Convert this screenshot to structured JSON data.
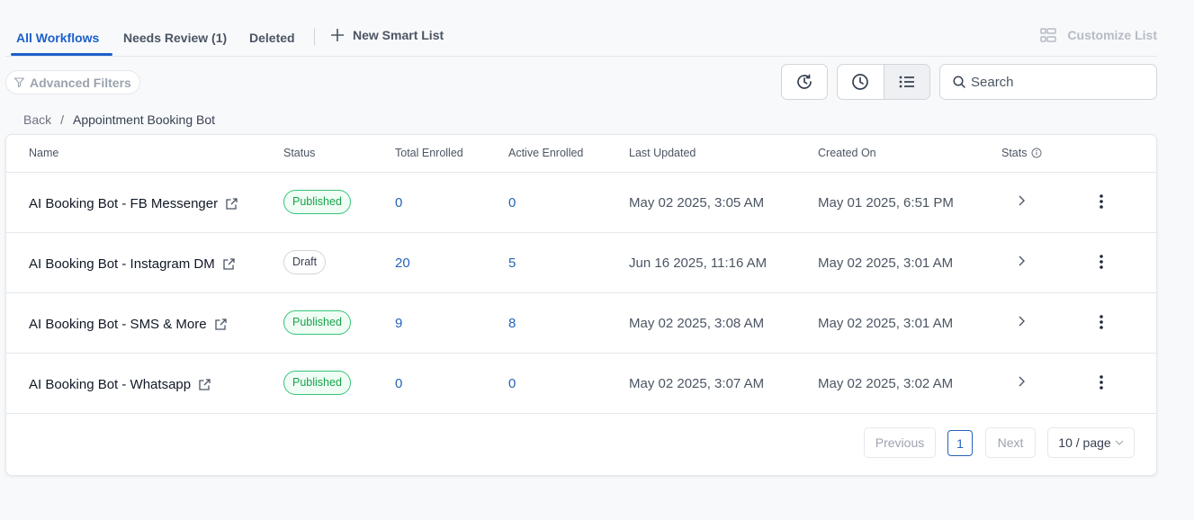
{
  "tabs": {
    "all": "All Workflows",
    "review": "Needs Review (1)",
    "deleted": "Deleted",
    "new_list": "New Smart List",
    "customize": "Customize List"
  },
  "filters": {
    "advanced": "Advanced Filters",
    "search_placeholder": "Search"
  },
  "breadcrumb": {
    "back": "Back",
    "separator": "/",
    "current": "Appointment Booking Bot"
  },
  "table": {
    "headers": {
      "name": "Name",
      "status": "Status",
      "total": "Total Enrolled",
      "active": "Active Enrolled",
      "updated": "Last Updated",
      "created": "Created On",
      "stats": "Stats"
    },
    "rows": [
      {
        "name": "AI Booking Bot - FB Messenger",
        "status": "Published",
        "total": "0",
        "active": "0",
        "updated": "May 02 2025, 3:05 AM",
        "created": "May 01 2025, 6:51 PM"
      },
      {
        "name": "AI Booking Bot - Instagram DM",
        "status": "Draft",
        "total": "20",
        "active": "5",
        "updated": "Jun 16 2025, 11:16 AM",
        "created": "May 02 2025, 3:01 AM"
      },
      {
        "name": "AI Booking Bot - SMS & More",
        "status": "Published",
        "total": "9",
        "active": "8",
        "updated": "May 02 2025, 3:08 AM",
        "created": "May 02 2025, 3:01 AM"
      },
      {
        "name": "AI Booking Bot - Whatsapp",
        "status": "Published",
        "total": "0",
        "active": "0",
        "updated": "May 02 2025, 3:07 AM",
        "created": "May 02 2025, 3:02 AM"
      }
    ]
  },
  "pagination": {
    "previous": "Previous",
    "current_page": "1",
    "next": "Next",
    "page_size": "10 / page"
  },
  "colors": {
    "accent": "#1d5fc9",
    "link": "#2563b8",
    "published": "#16a34a"
  }
}
